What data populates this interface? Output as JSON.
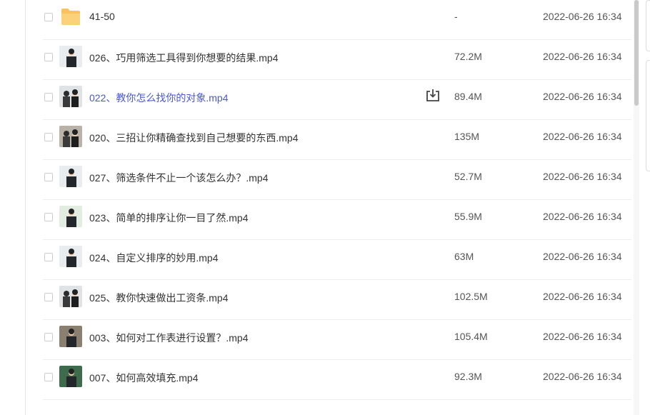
{
  "files": [
    {
      "name": "41-50",
      "size": "-",
      "date": "2022-06-26 16:34",
      "type": "folder",
      "thumb": "folder-icon",
      "highlight": false
    },
    {
      "name": "026、巧用筛选工具得到你想要的结果.mp4",
      "size": "72.2M",
      "date": "2022-06-26 16:34",
      "type": "video",
      "thumb": "teacher-whiteboard",
      "highlight": false
    },
    {
      "name": "022、教你怎么找你的对象.mp4",
      "size": "89.4M",
      "date": "2022-06-26 16:34",
      "type": "video",
      "thumb": "two-presenters",
      "highlight": true
    },
    {
      "name": "020、三招让你精确查找到自己想要的东西.mp4",
      "size": "135M",
      "date": "2022-06-26 16:34",
      "type": "video",
      "thumb": "two-presenters-dark",
      "highlight": false
    },
    {
      "name": "027、筛选条件不止一个该怎么办？.mp4",
      "size": "52.7M",
      "date": "2022-06-26 16:34",
      "type": "video",
      "thumb": "teacher-whiteboard",
      "highlight": false
    },
    {
      "name": "023、简单的排序让你一目了然.mp4",
      "size": "55.9M",
      "date": "2022-06-26 16:34",
      "type": "video",
      "thumb": "teacher-green",
      "highlight": false
    },
    {
      "name": "024、自定义排序的妙用.mp4",
      "size": "63M",
      "date": "2022-06-26 16:34",
      "type": "video",
      "thumb": "teacher-whiteboard",
      "highlight": false
    },
    {
      "name": "025、教你快速做出工资条.mp4",
      "size": "102.5M",
      "date": "2022-06-26 16:34",
      "type": "video",
      "thumb": "two-presenters",
      "highlight": false
    },
    {
      "name": "003、如何对工作表进行设置？.mp4",
      "size": "105.4M",
      "date": "2022-06-26 16:34",
      "type": "video",
      "thumb": "teacher-dark",
      "highlight": false
    },
    {
      "name": "007、如何高效填充.mp4",
      "size": "92.3M",
      "date": "2022-06-26 16:34",
      "type": "video",
      "thumb": "teacher-chalkboard",
      "highlight": false
    }
  ],
  "colors": {
    "link": "#4a58d6",
    "text": "#333333",
    "folder": "#f9c25c"
  }
}
